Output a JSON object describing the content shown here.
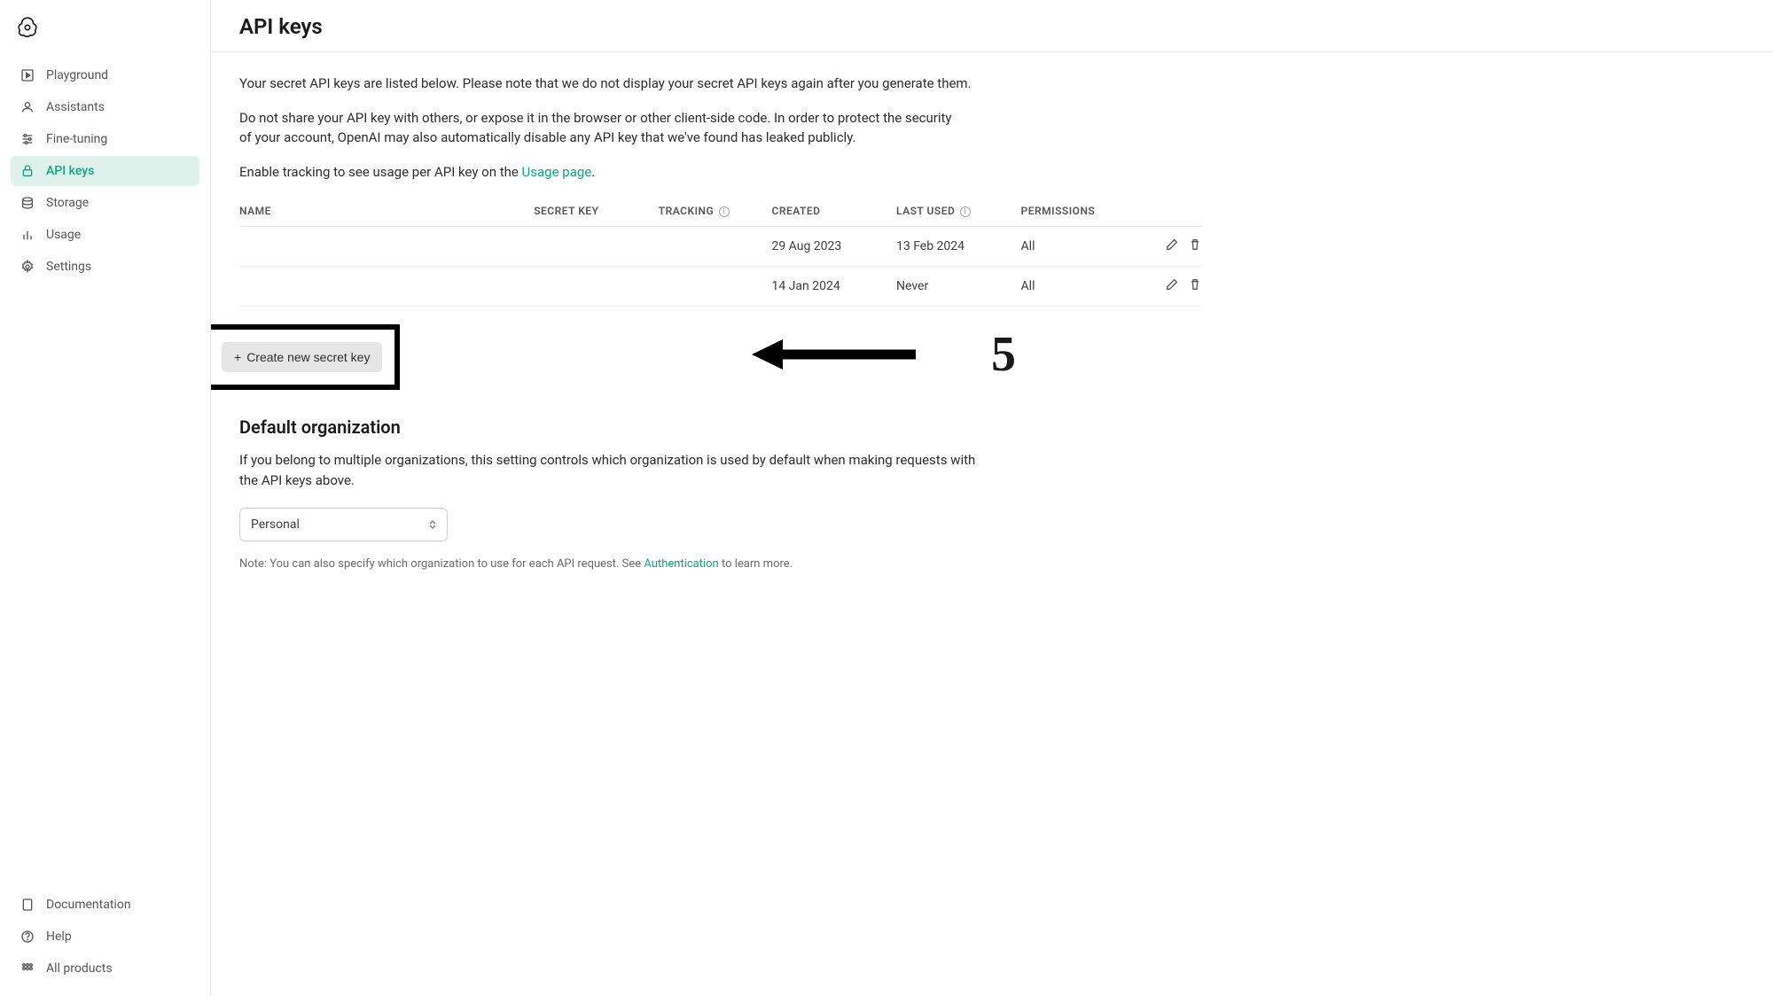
{
  "sidebar": {
    "items": [
      {
        "label": "Playground"
      },
      {
        "label": "Assistants"
      },
      {
        "label": "Fine-tuning"
      },
      {
        "label": "API keys"
      },
      {
        "label": "Storage"
      },
      {
        "label": "Usage"
      },
      {
        "label": "Settings"
      }
    ],
    "bottom_items": [
      {
        "label": "Documentation"
      },
      {
        "label": "Help"
      },
      {
        "label": "All products"
      }
    ]
  },
  "page": {
    "title": "API keys",
    "description1": "Your secret API keys are listed below. Please note that we do not display your secret API keys again after you generate them.",
    "description2": "Do not share your API key with others, or expose it in the browser or other client-side code. In order to protect the security of your account, OpenAI may also automatically disable any API key that we've found has leaked publicly.",
    "description3_pre": "Enable tracking to see usage per API key on the ",
    "description3_link": "Usage page",
    "description3_post": "."
  },
  "table": {
    "headers": {
      "name": "NAME",
      "secret": "SECRET KEY",
      "tracking": "TRACKING",
      "created": "CREATED",
      "last_used": "LAST USED",
      "permissions": "PERMISSIONS"
    },
    "rows": [
      {
        "created": "29 Aug 2023",
        "last_used": "13 Feb 2024",
        "permissions": "All"
      },
      {
        "created": "14 Jan 2024",
        "last_used": "Never",
        "permissions": "All"
      }
    ]
  },
  "create_button": "Create new secret key",
  "annotation": {
    "number": "5"
  },
  "default_org": {
    "title": "Default organization",
    "description": "If you belong to multiple organizations, this setting controls which organization is used by default when making requests with the API keys above.",
    "selected": "Personal",
    "note_pre": "Note: You can also specify which organization to use for each API request. See ",
    "note_link": "Authentication",
    "note_post": " to learn more."
  }
}
